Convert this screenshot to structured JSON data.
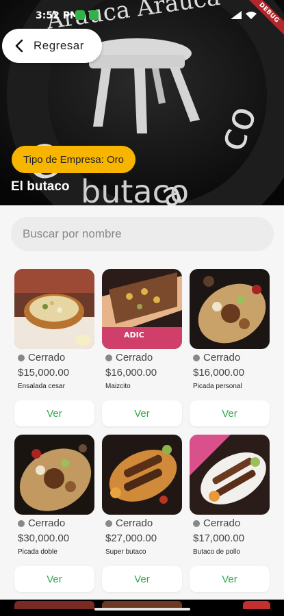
{
  "status_bar": {
    "time": "3:52 PM"
  },
  "debug_banner": "DEBUG",
  "hero": {
    "back_label": "Regresar",
    "company_type": "Tipo de Empresa: Oro",
    "shop_name": "El butaco",
    "logo_text_top": "Arauca Arauca",
    "logo_text_bottom": "butaco"
  },
  "search": {
    "placeholder": "Buscar por nombre"
  },
  "colors": {
    "badge": "#f7b500",
    "ver_green": "#2ea84a",
    "status_dot": "#888888"
  },
  "products": [
    {
      "status": "Cerrado",
      "price": "$15,000.00",
      "name": "Ensalada cesar",
      "button": "Ver"
    },
    {
      "status": "Cerrado",
      "price": "$16,000.00",
      "name": "Maizcito",
      "button": "Ver",
      "image_text": "ADIC"
    },
    {
      "status": "Cerrado",
      "price": "$16,000.00",
      "name": "Picada personal",
      "button": "Ver"
    },
    {
      "status": "Cerrado",
      "price": "$30,000.00",
      "name": "Picada doble",
      "button": "Ver"
    },
    {
      "status": "Cerrado",
      "price": "$27,000.00",
      "name": "Super butaco",
      "button": "Ver"
    },
    {
      "status": "Cerrado",
      "price": "$17,000.00",
      "name": "Butaco de pollo",
      "button": "Ver"
    }
  ]
}
